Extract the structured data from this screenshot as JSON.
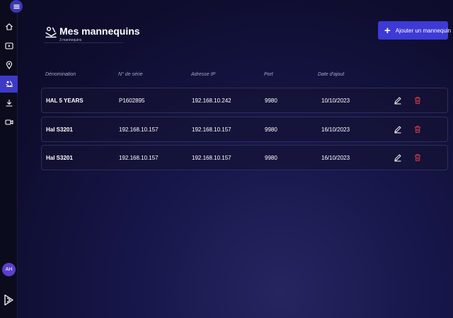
{
  "sidebar": {
    "avatar_initials": "AH",
    "items": [
      {
        "icon": "home-icon"
      },
      {
        "icon": "video-player-icon"
      },
      {
        "icon": "map-pin-icon"
      },
      {
        "icon": "mannequin-icon",
        "active": true
      },
      {
        "icon": "download-icon"
      },
      {
        "icon": "camera-icon"
      }
    ]
  },
  "header": {
    "title": "Mes mannequins",
    "subtitle": "3 mannequins",
    "add_button_label": "Ajouter un mannequin"
  },
  "table": {
    "columns": [
      "Dénomination",
      "N° de série",
      "Adresse IP",
      "Port",
      "Date d'ajout"
    ],
    "rows": [
      {
        "name": "HAL 5 YEARS",
        "serial": "P1602895",
        "ip": "192.168.10.242",
        "port": "9980",
        "date": "10/10/2023"
      },
      {
        "name": "Hal S3201",
        "serial": "192.168.10.157",
        "ip": "192.168.10.157",
        "port": "9980",
        "date": "16/10/2023"
      },
      {
        "name": "Hal S3201",
        "serial": "192.168.10.157",
        "ip": "192.168.10.157",
        "port": "9980",
        "date": "16/10/2023"
      }
    ]
  },
  "colors": {
    "accent": "#3d3ad6",
    "active_nav": "#3d3ac4",
    "delete": "#d43a4a",
    "avatar": "#5b3fc9"
  }
}
